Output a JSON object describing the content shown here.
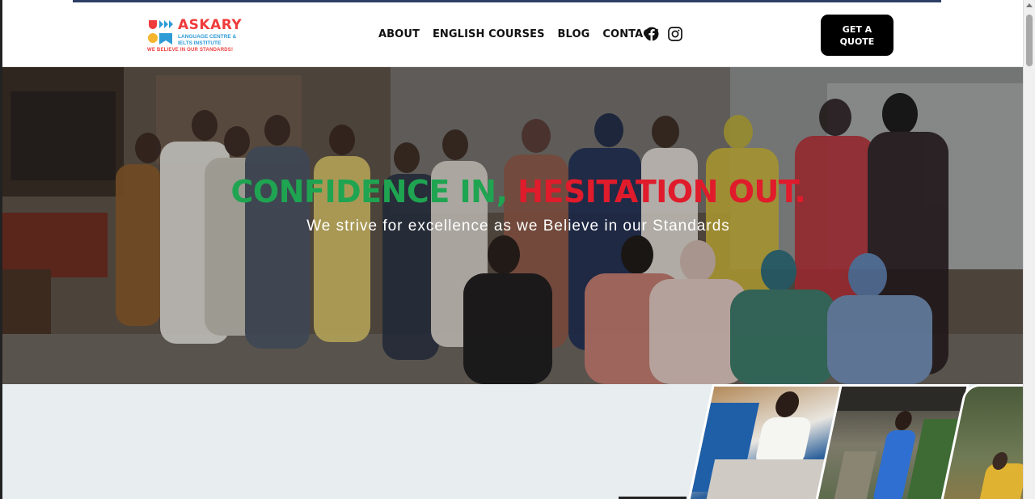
{
  "brand": {
    "name": "ASKARY",
    "subtitle": "LANGUAGE CENTRE & IELTS INSTITUTE",
    "tagline": "WE BELIEVE IN OUR STANDARDS!",
    "colors": {
      "red": "#ef3b3b",
      "blue": "#2e9bd6",
      "yellow": "#f5b52e"
    }
  },
  "nav": {
    "items": [
      {
        "label": "ABOUT"
      },
      {
        "label": "ENGLISH COURSES"
      },
      {
        "label": "BLOG"
      },
      {
        "label": "CONTACT"
      }
    ],
    "social": [
      {
        "icon": "facebook-icon"
      },
      {
        "icon": "instagram-icon"
      }
    ],
    "cta_label": "GET A QUOTE"
  },
  "hero": {
    "headline_part1": "CONFIDENCE IN,",
    "headline_part2": "HESITATION OUT.",
    "subheadline": "We strive for excellence as we Believe in our Standards",
    "colors": {
      "green": "#1fa451",
      "red": "#e01b2b"
    }
  }
}
